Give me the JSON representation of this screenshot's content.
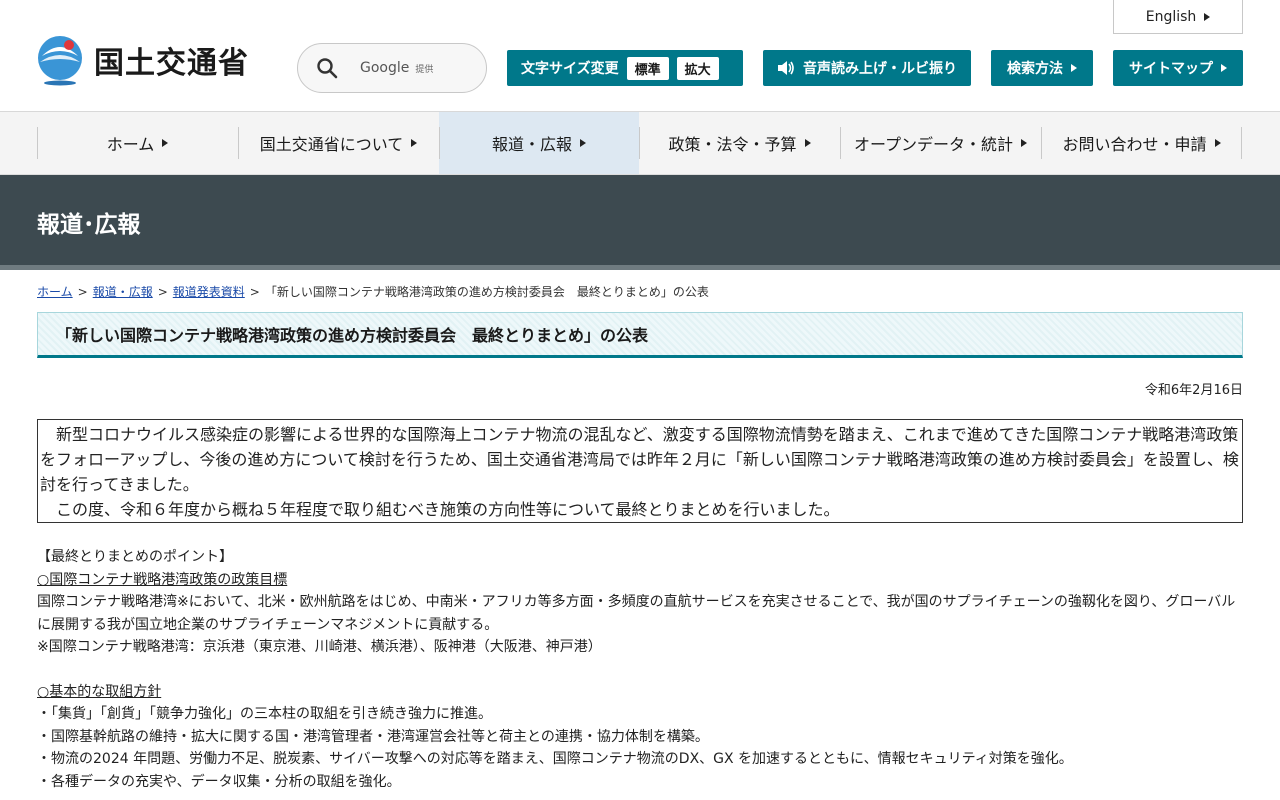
{
  "header": {
    "logo_text": "国土交通省",
    "search": {
      "brand": "Google",
      "sub": "提供"
    },
    "english_link": "English",
    "font_size": {
      "label": "文字サイズ変更",
      "options": [
        "標準",
        "拡大"
      ]
    },
    "voice_button": "音声読み上げ・ルビ振り",
    "search_method_button": "検索方法",
    "sitemap_button": "サイトマップ"
  },
  "nav": {
    "items": [
      {
        "label": "ホーム"
      },
      {
        "label": "国土交通省について"
      },
      {
        "label": "報道・広報"
      },
      {
        "label": "政策・法令・予算"
      },
      {
        "label": "オープンデータ・統計"
      },
      {
        "label": "お問い合わせ・申請"
      }
    ]
  },
  "banner": {
    "title": "報道･広報"
  },
  "breadcrumb": {
    "items": [
      "ホーム",
      "報道・広報",
      "報道発表資料"
    ],
    "current": "「新しい国際コンテナ戦略港湾政策の進め方検討委員会　最終とりまとめ」の公表"
  },
  "article": {
    "title": "「新しい国際コンテナ戦略港湾政策の進め方検討委員会　最終とりまとめ」の公表",
    "date": "令和6年2月16日",
    "intro": [
      "新型コロナウイルス感染症の影響による世界的な国際海上コンテナ物流の混乱など、激変する国際物流情勢を踏まえ、これまで進めてきた国際コンテナ戦略港湾政策をフォローアップし、今後の進め方について検討を行うため、国土交通省港湾局では昨年２月に「新しい国際コンテナ戦略港湾政策の進め方検討委員会」を設置し、検討を行ってきました。",
      "この度、令和６年度から概ね５年程度で取り組むべき施策の方向性等について最終とりまとめを行いました。"
    ],
    "points_heading": "【最終とりまとめのポイント】",
    "section1": {
      "heading": "○国際コンテナ戦略港湾政策の政策目標",
      "text": "国際コンテナ戦略港湾※において、北米・欧州航路をはじめ、中南米・アフリカ等多方面・多頻度の直航サービスを充実させることで、我が国のサプライチェーンの強靱化を図り、グローバルに展開する我が国立地企業のサプライチェーンマネジメントに貢献する。",
      "note": "※国際コンテナ戦略港湾：京浜港（東京港、川崎港、横浜港）、阪神港（大阪港、神戸港）"
    },
    "section2": {
      "heading": "○基本的な取組方針",
      "bullets": [
        "・「集貨」「創貨」「競争力強化」の三本柱の取組を引き続き強力に推進。",
        "・国際基幹航路の維持・拡大に関する国・港湾管理者・港湾運営会社等と荷主との連携・協力体制を構築。",
        "・物流の2024 年問題、労働力不足、脱炭素、サイバー攻撃への対応等を踏まえ、国際コンテナ物流のDX、GX を加速するとともに、情報セキュリティ対策を強化。",
        "・各種データの充実や、データ収集・分析の取組を強化。"
      ]
    }
  },
  "colors": {
    "accent": "#00788a",
    "banner": "#3d4a50",
    "nav_active": "#dde8f2"
  }
}
